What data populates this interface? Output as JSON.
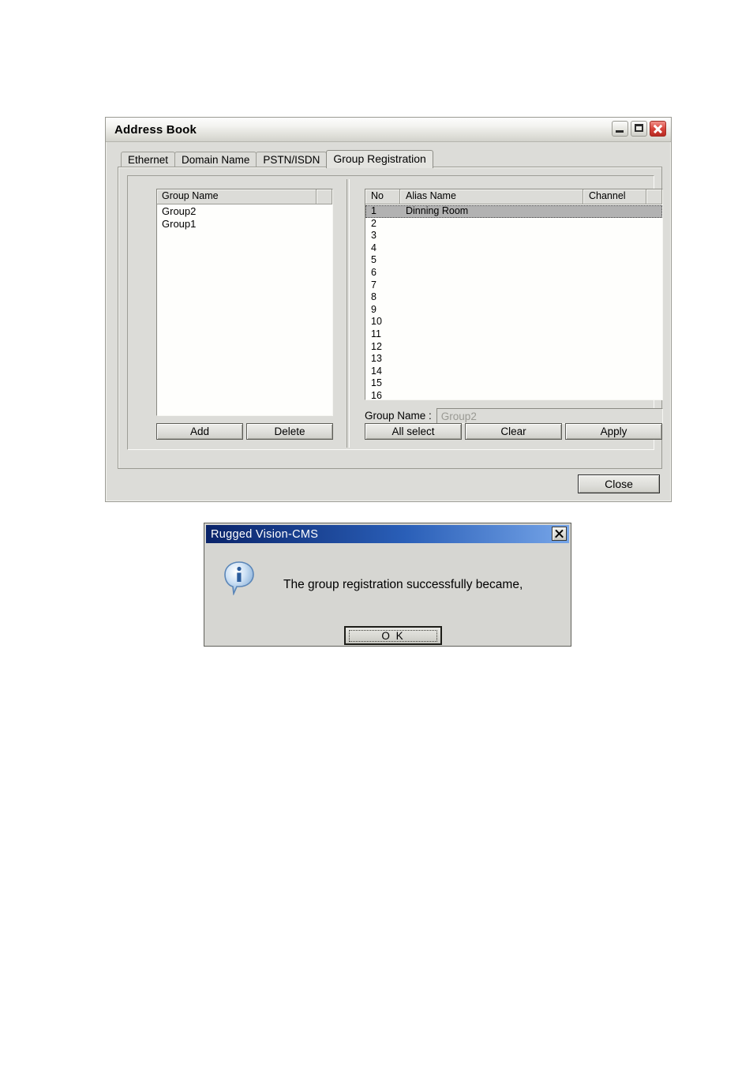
{
  "address_book": {
    "title": "Address Book",
    "window_buttons": {
      "minimize": "minimize-button",
      "maximize": "maximize-button",
      "close": "close-button"
    },
    "tabs": [
      {
        "label": "Ethernet",
        "selected": false
      },
      {
        "label": "Domain Name",
        "selected": false
      },
      {
        "label": "PSTN/ISDN",
        "selected": false
      },
      {
        "label": "Group Registration",
        "selected": true
      }
    ],
    "group_list": {
      "header": "Group Name",
      "items": [
        "Group2",
        "Group1"
      ]
    },
    "group_buttons": {
      "add": "Add",
      "delete": "Delete"
    },
    "member_grid": {
      "columns": [
        "No",
        "Alias Name",
        "Channel"
      ],
      "rows": [
        {
          "no": "1",
          "alias": "Dinning Room",
          "channel": "",
          "selected": true
        },
        {
          "no": "2",
          "alias": "",
          "channel": "",
          "selected": false
        },
        {
          "no": "3",
          "alias": "",
          "channel": "",
          "selected": false
        },
        {
          "no": "4",
          "alias": "",
          "channel": "",
          "selected": false
        },
        {
          "no": "5",
          "alias": "",
          "channel": "",
          "selected": false
        },
        {
          "no": "6",
          "alias": "",
          "channel": "",
          "selected": false
        },
        {
          "no": "7",
          "alias": "",
          "channel": "",
          "selected": false
        },
        {
          "no": "8",
          "alias": "",
          "channel": "",
          "selected": false
        },
        {
          "no": "9",
          "alias": "",
          "channel": "",
          "selected": false
        },
        {
          "no": "10",
          "alias": "",
          "channel": "",
          "selected": false
        },
        {
          "no": "11",
          "alias": "",
          "channel": "",
          "selected": false
        },
        {
          "no": "12",
          "alias": "",
          "channel": "",
          "selected": false
        },
        {
          "no": "13",
          "alias": "",
          "channel": "",
          "selected": false
        },
        {
          "no": "14",
          "alias": "",
          "channel": "",
          "selected": false
        },
        {
          "no": "15",
          "alias": "",
          "channel": "",
          "selected": false
        },
        {
          "no": "16",
          "alias": "",
          "channel": "",
          "selected": false
        }
      ]
    },
    "group_name_field": {
      "label": "Group Name :",
      "value": "Group2"
    },
    "member_buttons": {
      "all_select": "All select",
      "clear": "Clear",
      "apply": "Apply"
    },
    "close_button": "Close"
  },
  "message_dialog": {
    "title": "Rugged Vision-CMS",
    "close_label": "close-icon",
    "icon": "info-icon",
    "message": "The group registration successfully became,",
    "ok_button": "O K"
  },
  "colors": {
    "dialog_title_start": "#0a246a",
    "dialog_title_end": "#76a5e8",
    "window_face": "#dcdcd8",
    "selection": "#b2b2b2",
    "close_red": "#d8453c"
  }
}
